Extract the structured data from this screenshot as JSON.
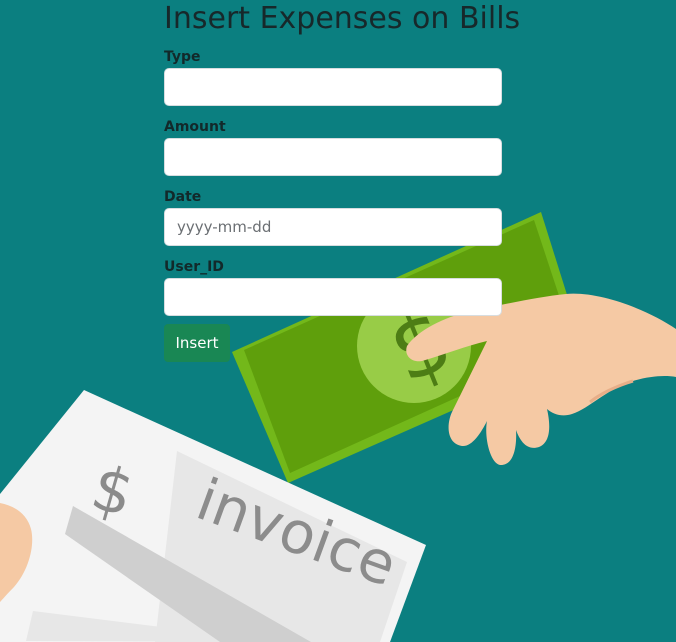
{
  "page": {
    "title": "Insert Expenses on Bills"
  },
  "form": {
    "type_label": "Type",
    "type_value": "",
    "amount_label": "Amount",
    "amount_value": "",
    "date_label": "Date",
    "date_placeholder": "yyyy-mm-dd",
    "date_value": "",
    "user_id_label": "User_ID",
    "user_id_value": "",
    "submit_label": "Insert"
  },
  "background": {
    "invoice_text": "invoice",
    "dollar_symbol": "$"
  },
  "colors": {
    "background": "#0b7f80",
    "button": "#198754",
    "money": "#6fb417",
    "hand": "#f5c9a4",
    "invoice_paper": "#f4f4f4"
  }
}
